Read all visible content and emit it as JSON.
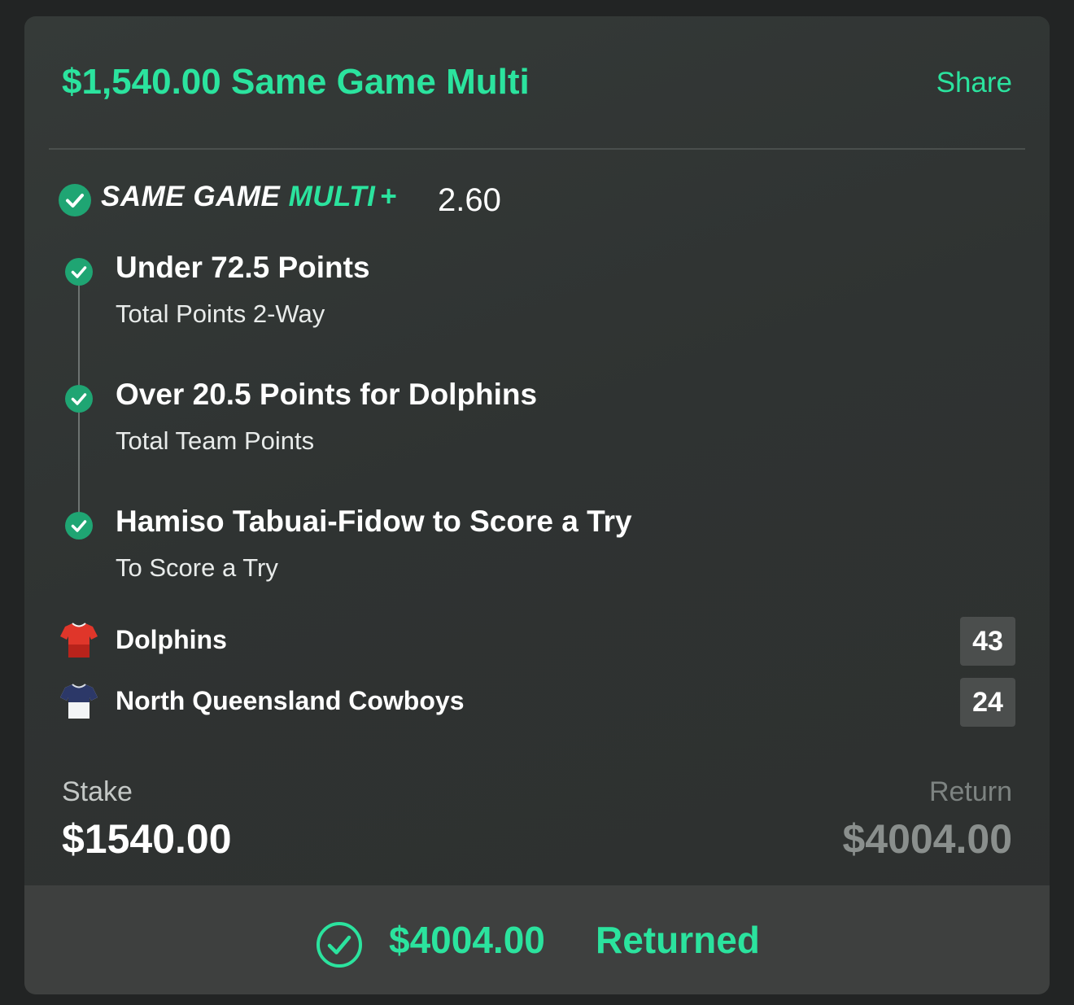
{
  "header": {
    "title": "$1,540.00 Same Game Multi",
    "share_label": "Share"
  },
  "bet_type": {
    "logo_word1": "SAME GAME",
    "logo_word2": "MULTI",
    "logo_plus": "+",
    "odds": "2.60",
    "status_icon": "check-circle-icon"
  },
  "legs": [
    {
      "selection": "Under 72.5 Points",
      "market": "Total Points 2-Way",
      "status_icon": "check-circle-icon"
    },
    {
      "selection": "Over 20.5 Points for Dolphins",
      "market": "Total Team Points",
      "status_icon": "check-circle-icon"
    },
    {
      "selection": "Hamiso Tabuai-Fidow to Score a Try",
      "market": "To Score a Try",
      "status_icon": "check-circle-icon"
    }
  ],
  "teams": [
    {
      "name": "Dolphins",
      "score": "43",
      "jersey_icon": "red-jersey-icon"
    },
    {
      "name": "North Queensland Cowboys",
      "score": "24",
      "jersey_icon": "navy-white-jersey-icon"
    }
  ],
  "summary": {
    "stake_label": "Stake",
    "stake_value": "$1540.00",
    "return_label": "Return",
    "return_value": "$4004.00"
  },
  "footer": {
    "amount": "$4004.00",
    "status": "Returned",
    "icon": "check-circle-outline-icon"
  },
  "colors": {
    "accent": "#2be39e",
    "check_fill": "#1fa573",
    "card_background": "#323634",
    "footer_background": "#3e403f"
  }
}
